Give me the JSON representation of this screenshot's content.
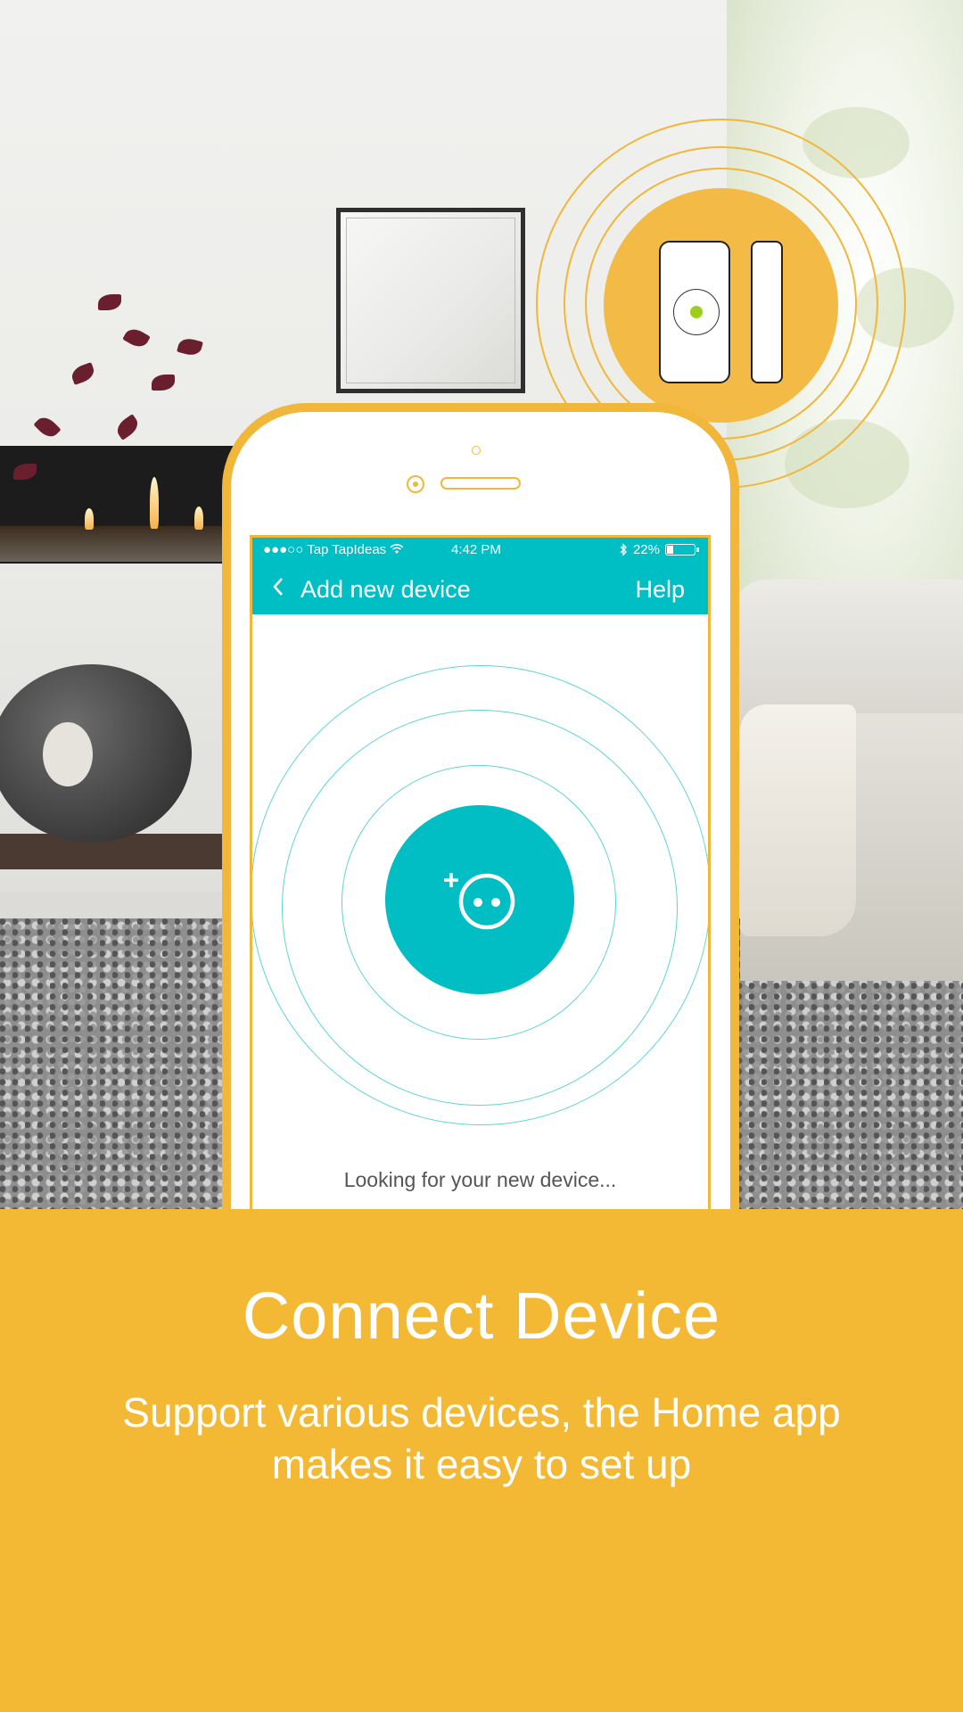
{
  "phone_screen": {
    "status_bar": {
      "carrier": "●●●○○ Tap TapIdeas",
      "wifi_icon": "wifi-icon",
      "time": "4:42 PM",
      "bluetooth_icon": "bluetooth-icon",
      "battery_percent": "22%",
      "battery_level": 0.22
    },
    "nav": {
      "back_icon": "chevron-left-icon",
      "title": "Add new device",
      "help_label": "Help"
    },
    "scan": {
      "center_icon": "add-plug-icon",
      "status_text": "Looking for your new device..."
    }
  },
  "promo": {
    "headline": "Connect Device",
    "subtitle_line1": "Support various devices, the Home app",
    "subtitle_line2": "makes it easy to set up"
  },
  "colors": {
    "accent_yellow": "#f3b934",
    "app_teal": "#00bfc4",
    "sensor_led_green": "#9ccf1a"
  }
}
